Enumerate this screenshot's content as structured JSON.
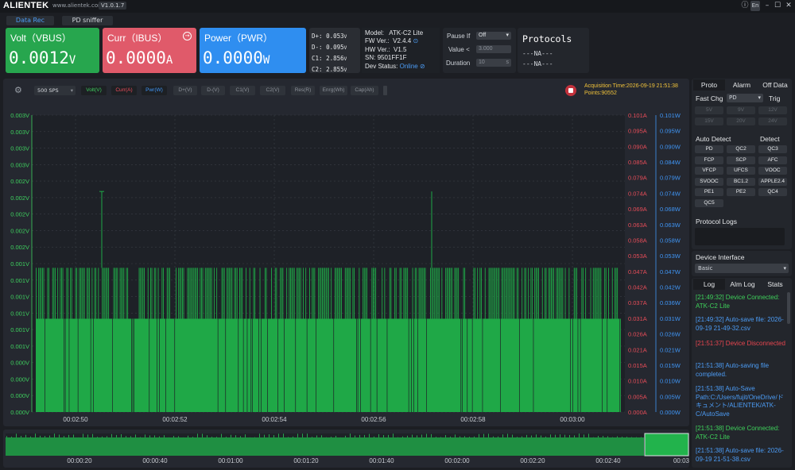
{
  "app": {
    "brand": "ALIENTEK",
    "site": "www.alientek.com",
    "version": "V1.0.1.7",
    "lang_button": "En"
  },
  "top_tabs": [
    {
      "label": "Data Rec",
      "active": true
    },
    {
      "label": "PD sniffer",
      "active": false
    }
  ],
  "cards": {
    "volt": {
      "label": "Volt（VBUS）",
      "value": "0.0012",
      "unit": "V",
      "color": "#27a64e"
    },
    "curr": {
      "label": "Curr（IBUS）",
      "value": "0.0000",
      "unit": "A",
      "color": "#e05a6a"
    },
    "power": {
      "label": "Power（PWR）",
      "value": "0.0000",
      "unit": "W",
      "color": "#2f8ef0"
    }
  },
  "dlines": [
    {
      "label": "D+:",
      "value": "0.053",
      "unit": "V"
    },
    {
      "label": "D-:",
      "value": "0.095",
      "unit": "V"
    },
    {
      "label": "C1:",
      "value": "2.856",
      "unit": "V"
    },
    {
      "label": "C2:",
      "value": "2.855",
      "unit": "V"
    }
  ],
  "device_info": {
    "model_label": "Model:",
    "model": "ATK-C2 Lite",
    "fw_label": "FW Ver.:",
    "fw": "V2.4.4",
    "hw_label": "HW Ver.:",
    "hw": "V1.5",
    "sn_label": "SN:",
    "sn": "9501FF1F",
    "status_label": "Dev Status:",
    "status": "Online"
  },
  "pause": {
    "pause_label": "Pause If",
    "pause_value": "Off",
    "value_label": "Value <",
    "value_placeholder": "3.000",
    "duration_label": "Duration",
    "duration_value": "10"
  },
  "protocols": {
    "title": "Protocols",
    "line1": "---NA---",
    "line2": "---NA---"
  },
  "toolbar": {
    "rate": "500 SPS",
    "channels": [
      {
        "label": "Volt(V)",
        "active": true,
        "color": "#3ecf5e"
      },
      {
        "label": "Curr(A)",
        "active": true,
        "color": "#ef4c5a"
      },
      {
        "label": "Pwr(W)",
        "active": true,
        "color": "#3f95f5"
      },
      {
        "label": "D+(V)",
        "active": false
      },
      {
        "label": "D-(V)",
        "active": false
      },
      {
        "label": "C1(V)",
        "active": false
      },
      {
        "label": "C2(V)",
        "active": false
      },
      {
        "label": "Res(R)",
        "active": false
      },
      {
        "label": "Enrg(Wh)",
        "active": false
      },
      {
        "label": "Cap(Ah)",
        "active": false
      }
    ],
    "acq_time": "Acquisition Time:2026-09-19 21:51:38",
    "points": "Points:90552"
  },
  "chart_data": [
    {
      "type": "bar",
      "title": "",
      "y_left_ticks": [
        "0.000V",
        "0.000V",
        "0.000V",
        "0.000V",
        "0.001V",
        "0.001V",
        "0.001V",
        "0.001V",
        "0.001V",
        "0.001V",
        "0.002V",
        "0.002V",
        "0.002V",
        "0.002V",
        "0.002V",
        "0.003V",
        "0.003V",
        "0.003V",
        "0.003V"
      ],
      "y_mid_ticks": [
        "0.000A",
        "0.005A",
        "0.010A",
        "0.015A",
        "0.021A",
        "0.026A",
        "0.031A",
        "0.037A",
        "0.042A",
        "0.047A",
        "0.053A",
        "0.058A",
        "0.063A",
        "0.069A",
        "0.074A",
        "0.079A",
        "0.085A",
        "0.090A",
        "0.095A",
        "0.101A"
      ],
      "y_right_ticks": [
        "0.000W",
        "0.005W",
        "0.010W",
        "0.015W",
        "0.021W",
        "0.026W",
        "0.031W",
        "0.036W",
        "0.042W",
        "0.047W",
        "0.053W",
        "0.058W",
        "0.063W",
        "0.068W",
        "0.074W",
        "0.079W",
        "0.084W",
        "0.090W",
        "0.095W",
        "0.101W"
      ],
      "x_ticks": [
        "00:02:50",
        "00:02:52",
        "00:02:54",
        "00:02:56",
        "00:02:58",
        "00:03:00"
      ],
      "ylim": [
        0,
        0.0035
      ],
      "series": [
        {
          "name": "Volt(V)",
          "color": "#1fa847",
          "levels": [
            0.0011,
            0.0017
          ],
          "spikes": [
            0.0026,
            0.0026
          ]
        }
      ]
    },
    {
      "type": "area",
      "x_ticks": [
        "00:00:20",
        "00:00:40",
        "00:01:00",
        "00:01:20",
        "00:01:40",
        "00:02:00",
        "00:02:20",
        "00:02:40",
        "00:03"
      ]
    }
  ],
  "right": {
    "tabs": [
      "Proto",
      "Alarm",
      "Off Data"
    ],
    "fast_chg_label": "Fast Chg",
    "fast_chg_value": "PD",
    "trig_label": "Trig",
    "volt_buttons": [
      "5V",
      "9V",
      "12V",
      "15V",
      "20V",
      "24V"
    ],
    "auto_detect_label": "Auto Detect",
    "detect_label": "Detect",
    "protocols": [
      "PD",
      "QC2",
      "QC3",
      "FCP",
      "SCP",
      "AFC",
      "VFCP",
      "UFCS",
      "VOOC",
      "SVOOC",
      "BC1.2",
      "APPLE2.4",
      "PE1",
      "PE2",
      "QC4",
      "QC5"
    ],
    "protocol_logs_label": "Protocol Logs",
    "device_interface_label": "Device Interface",
    "device_interface_value": "Basic",
    "log_tabs": [
      "Log",
      "Alm Log",
      "Stats"
    ],
    "logs": [
      {
        "text": "[21:49:32] Device Connected: ATK-C2 Lite",
        "color": "#3ed05a"
      },
      {
        "text": "[21:49:32] Auto-save file: 2026-09-19 21-49-32.csv",
        "color": "#4c9cf5"
      },
      {
        "text": "[21:51:37] Device Disconnected",
        "color": "#e8454f"
      },
      {
        "text": "[21:51:38] Auto-saving file completed.",
        "color": "#4c9cf5"
      },
      {
        "text": "[21:51:38] Auto-Save Path:C:/Users/fujit/OneDrive/ドキュメント/ALIENTEK/ATK-C/AutoSave",
        "color": "#4c9cf5"
      },
      {
        "text": "[21:51:38] Device Connected: ATK-C2 Lite",
        "color": "#3ed05a"
      },
      {
        "text": "[21:51:38] Auto-save file: 2026-09-19 21-51-38.csv",
        "color": "#4c9cf5"
      }
    ]
  }
}
